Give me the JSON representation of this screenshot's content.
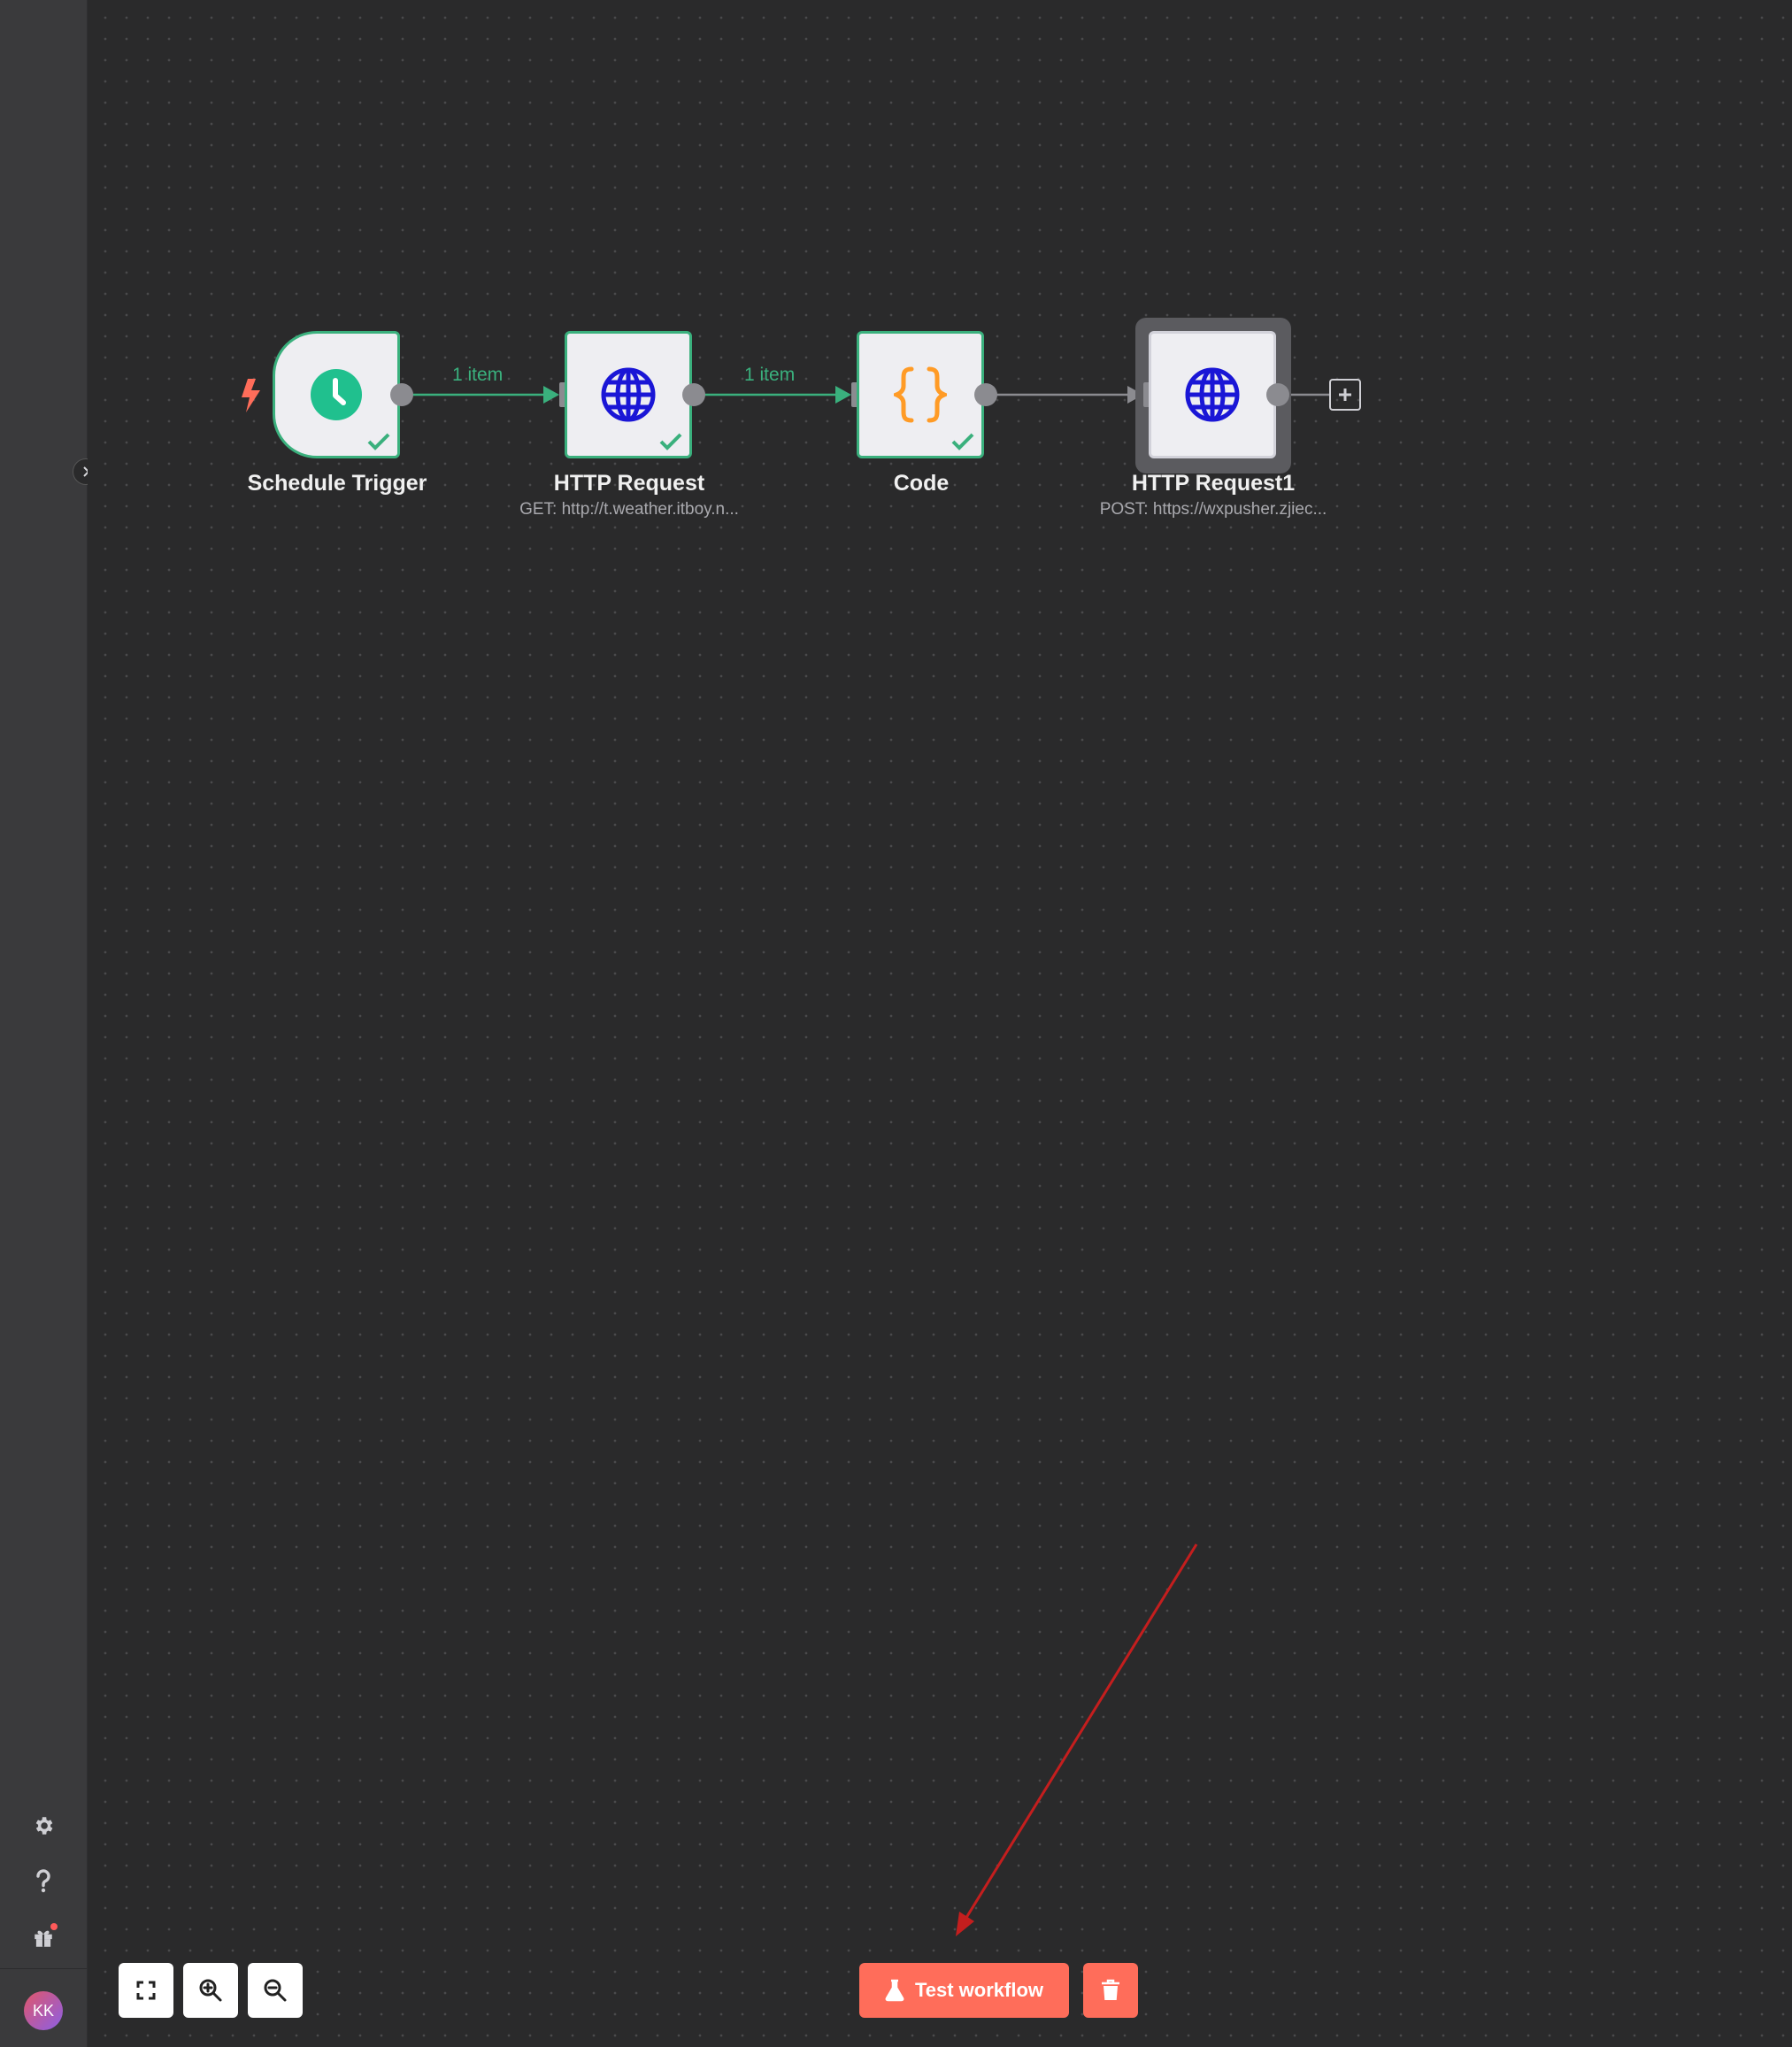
{
  "nodes": [
    {
      "label": "Schedule Trigger",
      "subtitle": ""
    },
    {
      "label": "HTTP Request",
      "subtitle": "GET: http://t.weather.itboy.n..."
    },
    {
      "label": "Code",
      "subtitle": ""
    },
    {
      "label": "HTTP Request1",
      "subtitle": "POST: https://wxpusher.zjiec..."
    }
  ],
  "edges": [
    {
      "label": "1 item"
    },
    {
      "label": "1 item"
    }
  ],
  "buttons": {
    "test_workflow": "Test workflow"
  },
  "user": {
    "initials": "KK"
  },
  "icons": {
    "trigger": "lightning-bolt-icon",
    "schedule": "clock-icon",
    "http": "globe-icon",
    "code": "curly-braces-icon",
    "settings": "gear-icon",
    "help": "question-icon",
    "whats_new": "gift-icon",
    "zoom_fit": "fit-to-view-icon",
    "zoom_in": "zoom-in-icon",
    "zoom_out": "zoom-out-icon",
    "test": "flask-icon",
    "delete": "trash-icon",
    "add": "plus-icon",
    "expand": "chevron-right-icon"
  },
  "colors": {
    "success": "#3ab07d",
    "accent": "#ff6d5a",
    "clock_bg": "#20c08e",
    "globe": "#1a16d6",
    "code": "#ff9b26",
    "annotation_arrow": "#c41e1e"
  }
}
